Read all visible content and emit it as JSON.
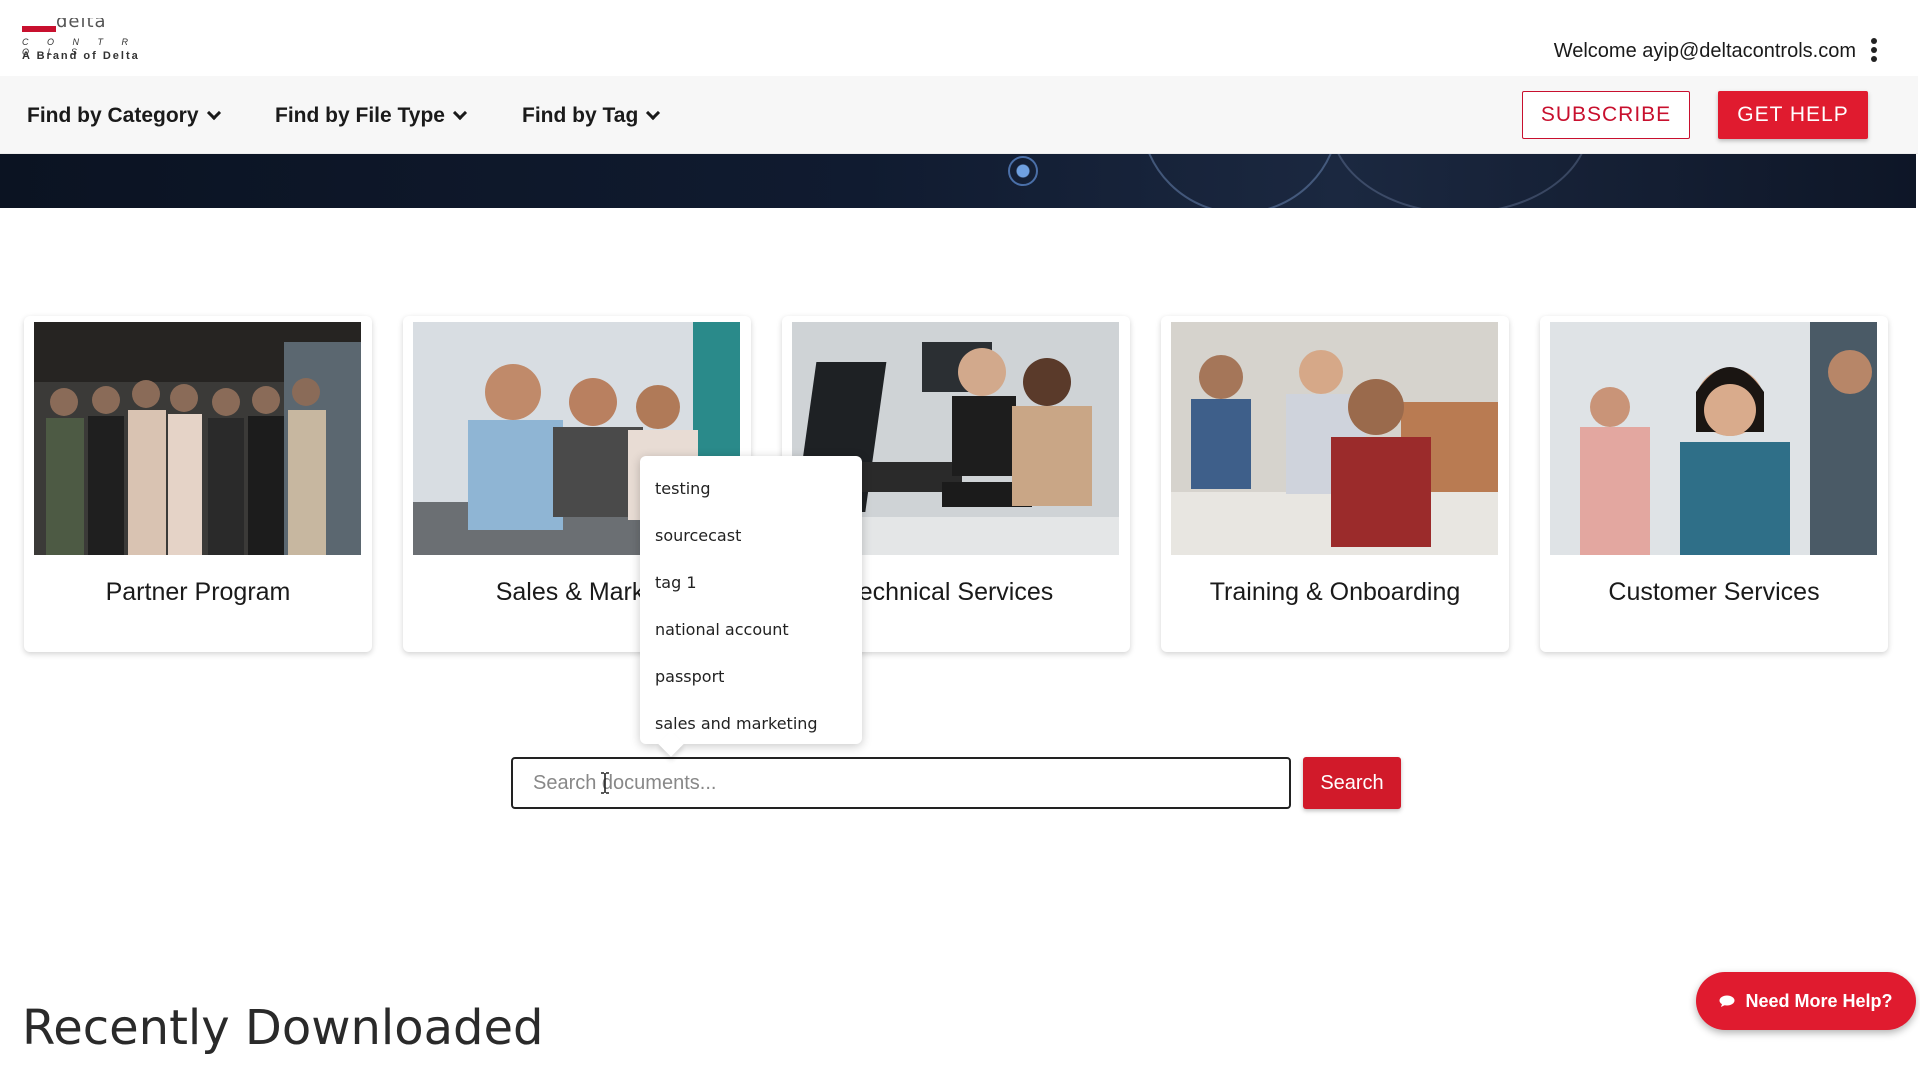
{
  "header": {
    "logo_controls": "C O N T R O L S",
    "logo_brand": "A Brand of Delta",
    "welcome": "Welcome ayip@deltacontrols.com"
  },
  "nav": {
    "items": [
      {
        "label": "Find by Category"
      },
      {
        "label": "Find by File Type"
      },
      {
        "label": "Find by Tag"
      }
    ],
    "subscribe_label": "SUBSCRIBE",
    "gethelp_label": "GET HELP"
  },
  "cards": [
    {
      "title": "Partner Program"
    },
    {
      "title": "Sales & Marke"
    },
    {
      "title": "echnical Services"
    },
    {
      "title": "Training & Onboarding"
    },
    {
      "title": "Customer Services"
    }
  ],
  "tag_dropdown": {
    "options": [
      "testing",
      "sourcecast",
      "tag 1",
      "national account",
      "passport",
      "sales and marketing"
    ]
  },
  "search": {
    "placeholder": "Search documents...",
    "button_label": "Search"
  },
  "recent": {
    "heading": "Recently Downloaded"
  },
  "help": {
    "label": "Need More Help?"
  },
  "colors": {
    "brand_red": "#e01b2f",
    "nav_bg": "#f7f7f7",
    "hero_dark": "#0b1322"
  }
}
